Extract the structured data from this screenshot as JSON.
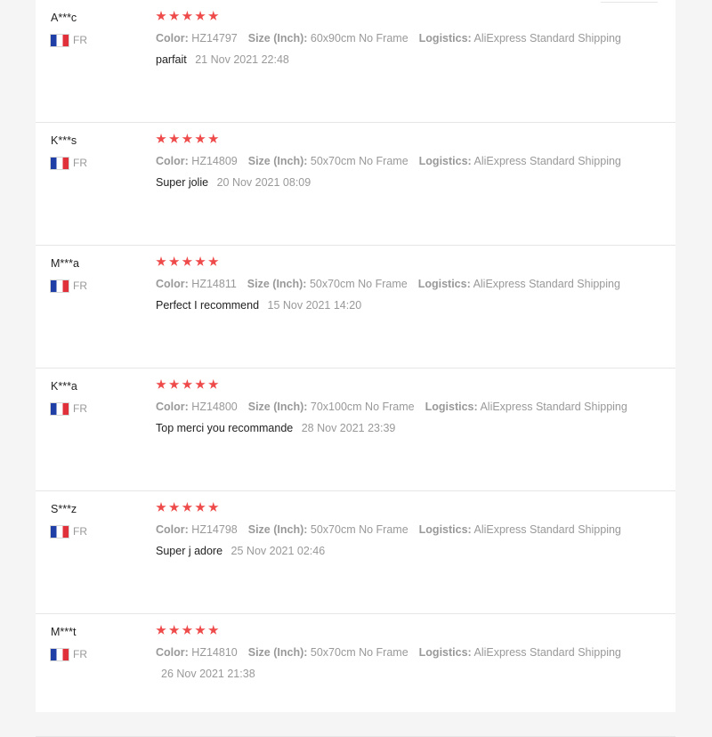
{
  "colors": {
    "star": "#ef4a4a",
    "text_primary": "#222222",
    "text_secondary": "#999999",
    "divider": "#e6e6e6"
  },
  "labels": {
    "color": "Color:",
    "size": "Size (Inch):",
    "logistics": "Logistics:"
  },
  "reviews": [
    {
      "user": "A***c",
      "country": "FR",
      "stars": 5,
      "color": "HZ14797",
      "size": "60x90cm No Frame",
      "logistics": "AliExpress Standard Shipping",
      "text": "parfait",
      "date": "21 Nov 2021 22:48"
    },
    {
      "user": "K***s",
      "country": "FR",
      "stars": 5,
      "color": "HZ14809",
      "size": "50x70cm No Frame",
      "logistics": "AliExpress Standard Shipping",
      "text": "Super jolie",
      "date": "20 Nov 2021 08:09"
    },
    {
      "user": "M***a",
      "country": "FR",
      "stars": 5,
      "color": "HZ14811",
      "size": "50x70cm No Frame",
      "logistics": "AliExpress Standard Shipping",
      "text": "Perfect I recommend",
      "date": "15 Nov 2021 14:20"
    },
    {
      "user": "K***a",
      "country": "FR",
      "stars": 5,
      "color": "HZ14800",
      "size": "70x100cm No Frame",
      "logistics": "AliExpress Standard Shipping",
      "text": "Top merci you recommande",
      "date": "28 Nov 2021 23:39"
    },
    {
      "user": "S***z",
      "country": "FR",
      "stars": 5,
      "color": "HZ14798",
      "size": "50x70cm No Frame",
      "logistics": "AliExpress Standard Shipping",
      "text": "Super j adore",
      "date": "25 Nov 2021 02:46"
    },
    {
      "user": "M***t",
      "country": "FR",
      "stars": 5,
      "color": "HZ14810",
      "size": "50x70cm No Frame",
      "logistics": "AliExpress Standard Shipping",
      "text": "",
      "date": "26 Nov 2021 21:38"
    }
  ]
}
